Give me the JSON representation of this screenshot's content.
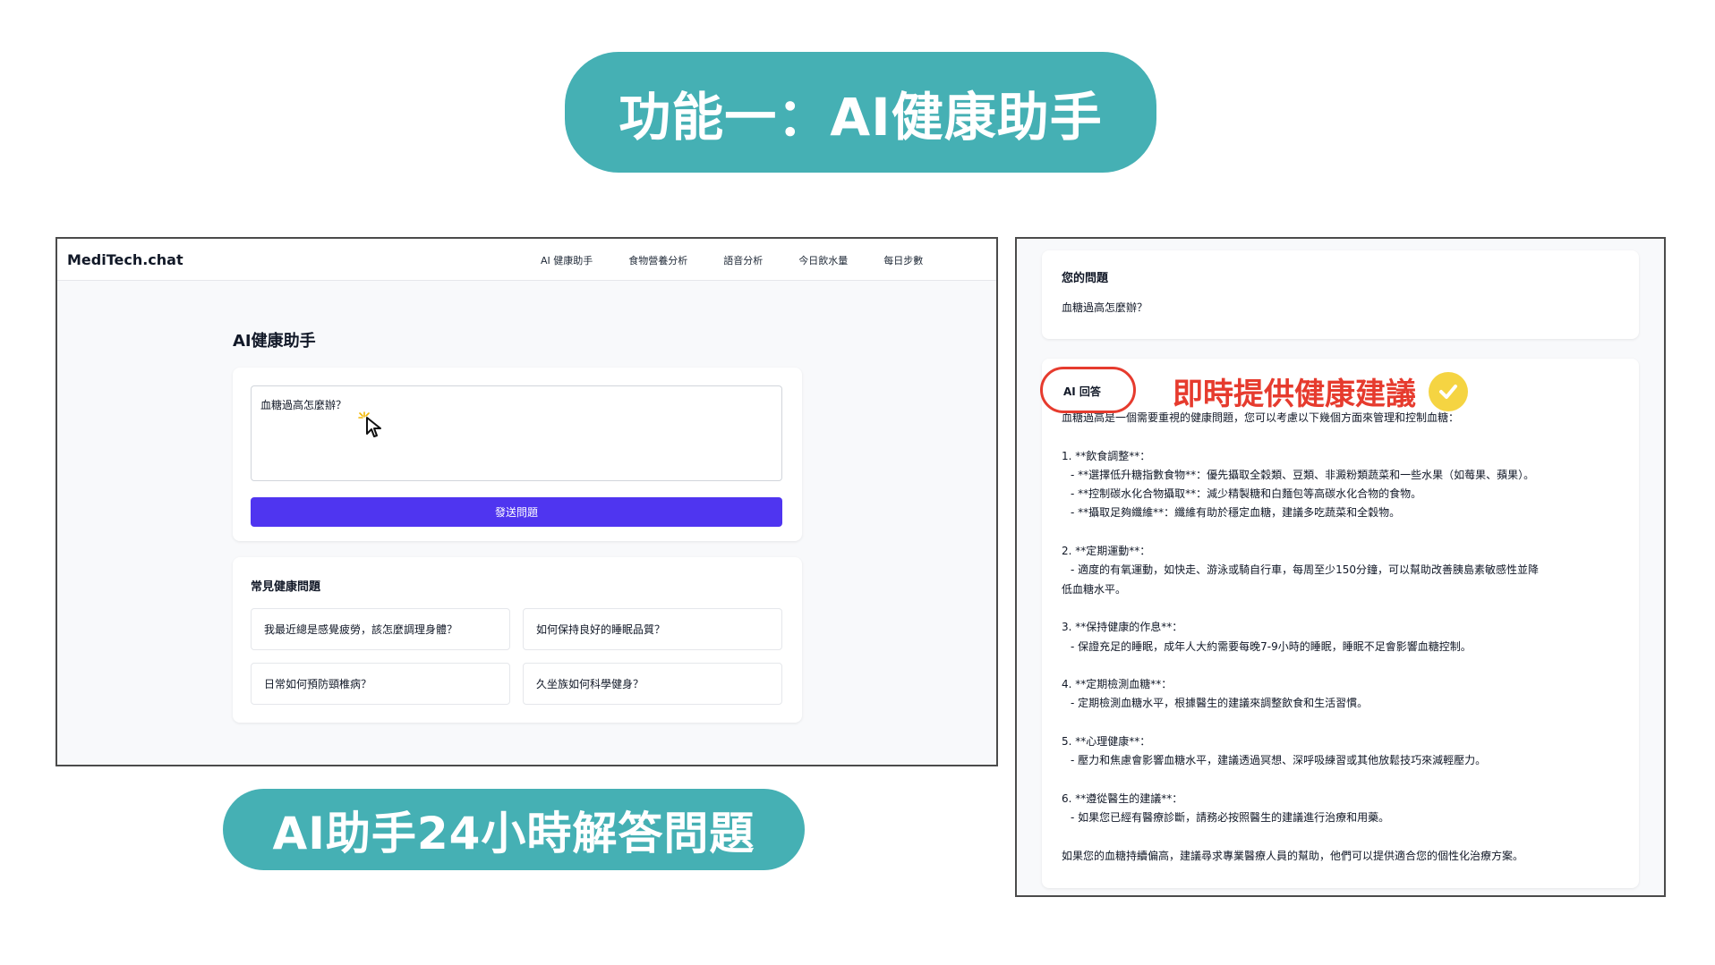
{
  "title_banner": "功能一：AI健康助手",
  "caption_banner": "AI助手24小時解答問題",
  "colors": {
    "banner": "#45b0b4",
    "send_button": "#4f35f0",
    "highlight": "#e63b2e",
    "check": "#f5d442"
  },
  "left_screen": {
    "brand": "MediTech.chat",
    "nav": [
      "AI 健康助手",
      "食物營養分析",
      "語音分析",
      "今日飲水量",
      "每日步數"
    ],
    "page_title": "AI健康助手",
    "question_input": "血糖過高怎麼辦？",
    "send_button": "發送問題",
    "faq_title": "常見健康問題",
    "faq": [
      "我最近總是感覺疲勞，該怎麼調理身體？",
      "如何保持良好的睡眠品質？",
      "日常如何預防頸椎病？",
      "久坐族如何科學健身？"
    ],
    "cursor_icon": "pointer-cursor-icon"
  },
  "right_screen": {
    "question_label": "您的問題",
    "question_text": "血糖過高怎麼辦？",
    "answer_label": "AI 回答",
    "highlight_text": "即時提供健康建議",
    "check_icon": "check-circle-icon",
    "answer_lines": [
      "血糖過高是一個需要重視的健康問題，您可以考慮以下幾個方面來管理和控制血糖：",
      "",
      "1. **飲食調整**：",
      " - **選擇低升糖指數食物**：優先攝取全穀類、豆類、非澱粉類蔬菜和一些水果（如莓果、蘋果）。",
      " - **控制碳水化合物攝取**：減少精製糖和白麵包等高碳水化合物的食物。",
      " - **攝取足夠纖維**：纖維有助於穩定血糖，建議多吃蔬菜和全穀物。",
      "",
      "2. **定期運動**：",
      " - 適度的有氧運動，如快走、游泳或騎自行車，每周至少150分鐘，可以幫助改善胰島素敏感性並降",
      "低血糖水平。",
      "",
      "3. **保持健康的作息**：",
      " - 保證充足的睡眠，成年人大約需要每晚7-9小時的睡眠，睡眠不足會影響血糖控制。",
      "",
      "4. **定期檢測血糖**：",
      " - 定期檢測血糖水平，根據醫生的建議來調整飲食和生活習慣。",
      "",
      "5. **心理健康**：",
      " - 壓力和焦慮會影響血糖水平，建議透過冥想、深呼吸練習或其他放鬆技巧來減輕壓力。",
      "",
      "6. **遵從醫生的建議**：",
      " - 如果您已經有醫療診斷，請務必按照醫生的建議進行治療和用藥。",
      "",
      "如果您的血糖持續偏高，建議尋求專業醫療人員的幫助，他們可以提供適合您的個性化治療方案。"
    ]
  }
}
